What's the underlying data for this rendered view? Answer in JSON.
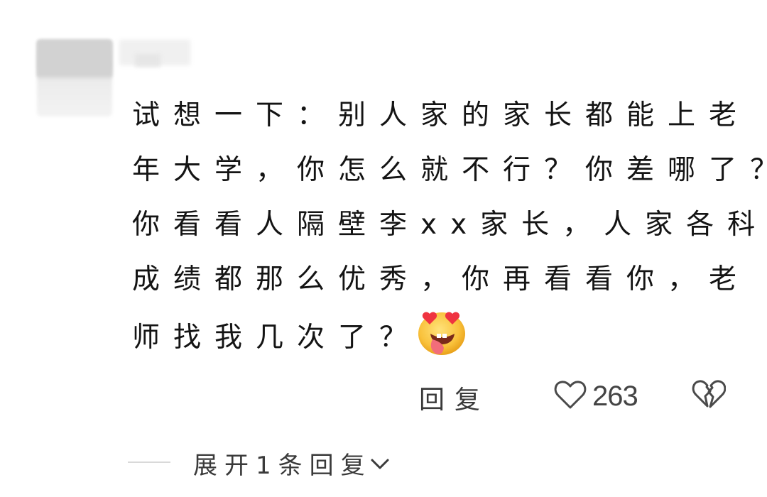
{
  "comment": {
    "lines": [
      "试想一下：别人家的家长都能上老",
      "年大学，你怎么就不行？你差哪了？",
      "你看看人隔壁李xx家长，人家各科",
      "成绩都那么优秀，你再看看你，老",
      "师找我几次了？"
    ],
    "emoji_icon": "heart-eyes-tongue-emoji"
  },
  "actions": {
    "reply_label": "回复",
    "like_icon": "heart-outline-icon",
    "like_count": "263",
    "dislike_icon": "broken-heart-icon"
  },
  "replies": {
    "expand_label": "展开1条回复",
    "chevron_icon": "chevron-down-icon"
  },
  "colors": {
    "text": "#141414",
    "secondary_text": "#3a3a3a",
    "icon": "#444444",
    "divider": "#d9d9d9"
  }
}
